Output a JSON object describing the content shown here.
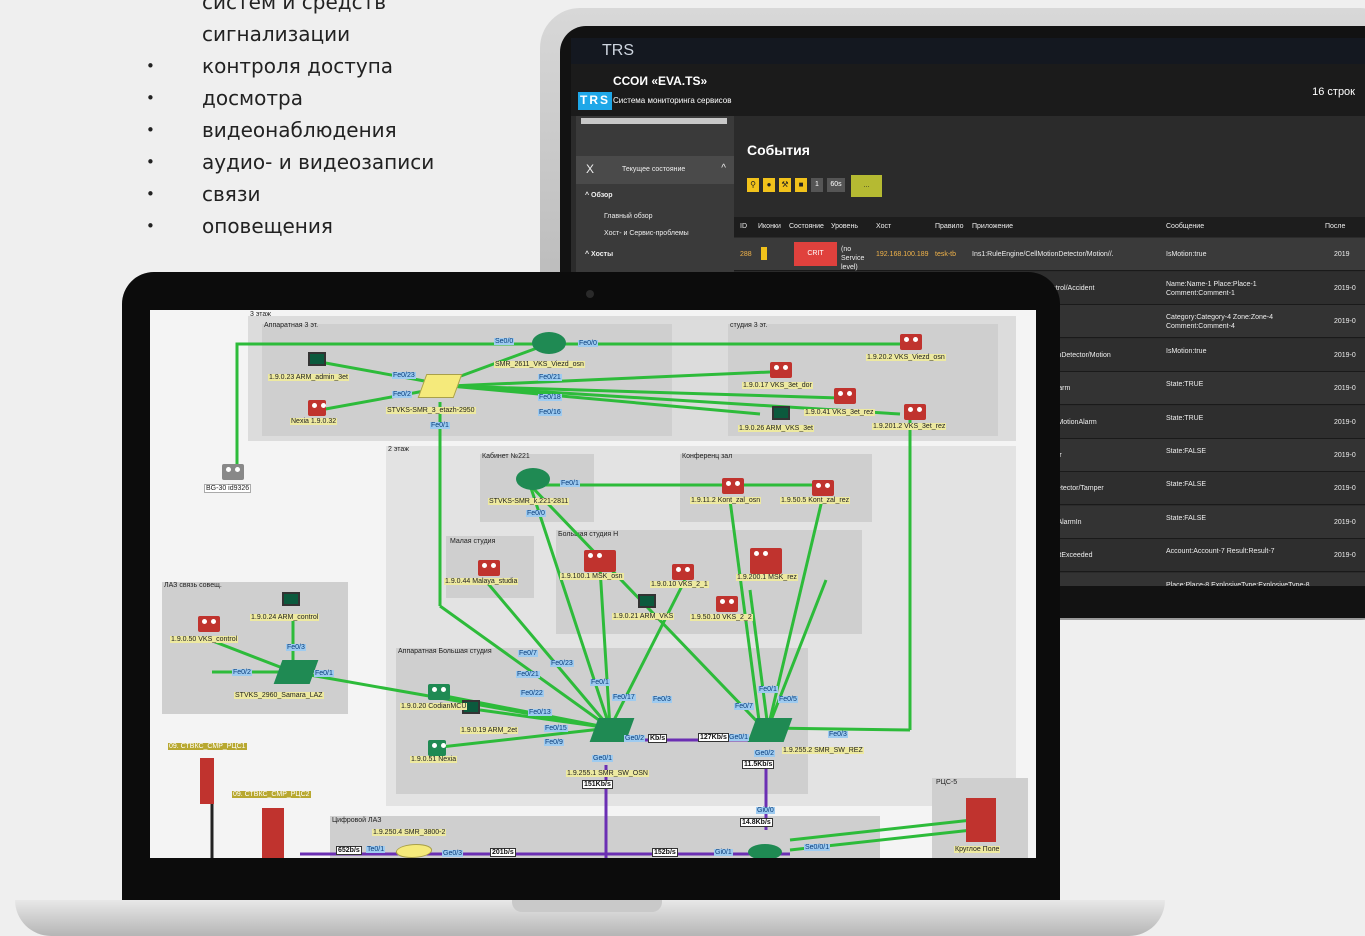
{
  "bullets": {
    "items": [
      "систем и средств",
      "сигнализации",
      "контроля доступа",
      "досмотра",
      "видеонаблюдения",
      "аудио- и видеозаписи",
      "связи",
      "оповещения"
    ],
    "bullet_char": "•"
  },
  "tablet": {
    "titlebar": "TRS",
    "app_name": "ССОИ «EVA.TS»",
    "logo": "TRS",
    "app_subtitle": "Система мониторинга сервисов",
    "rows_count": "16 строк",
    "sidebar": {
      "panel_close": "X",
      "panel_title": "Текущее состояние",
      "overview": "^ Обзор",
      "main_overview": "Главный обзор",
      "host_problems": "Хост- и Сервис-проблемы",
      "hosts": "^ Хосты"
    },
    "events_title": "События",
    "toolbar": {
      "num1": "1",
      "num2": "60s",
      "go": "..."
    },
    "table": {
      "headers": [
        "ID",
        "Иконки",
        "Состояние",
        "Уровень",
        "Хост",
        "Правило",
        "Приложение",
        "Сообщение",
        "После"
      ],
      "first_row": {
        "id": "288",
        "state": "CRIT",
        "level": "(no Service level)",
        "host": "192.168.100.189",
        "rule": "tesk-tb",
        "app": "Ins1:RuleEngine/CellMotionDetector/Motion//.",
        "message": "IsMotion:true",
        "date": "2019"
      },
      "rows": [
        {
          "app": "ntrol/Accident",
          "message": "Name:Name-1 Place:Place-1 Comment:Comment-1",
          "date": "2019-0"
        },
        {
          "app": "re",
          "message": "Category:Category-4 Zone:Zone-4 Comment:Comment-4",
          "date": "2019-0"
        },
        {
          "app": "ionDetector/Motion",
          "message": "IsMotion:true",
          "date": "2019-0"
        },
        {
          "app": "Alarm",
          "message": "State:TRUE",
          "date": "2019-0"
        },
        {
          "app": "k:MotionAlarm",
          "message": "State:TRUE",
          "date": "2019-0"
        },
        {
          "app": "ver",
          "message": "State:FALSE",
          "date": "2019-0"
        },
        {
          "app": "Detector/Tamper",
          "message": "State:FALSE",
          "date": "2019-0"
        },
        {
          "app": "k:AlarmIn",
          "message": "State:FALSE",
          "date": "2019-0"
        },
        {
          "app": "mitExceeded",
          "message": "Account:Account-7 Result:Result-7",
          "date": "2019-0"
        },
        {
          "app": "",
          "message": "Place:Place-8 ExplosiveType:ExplosiveType-8",
          "date": "2019-0"
        }
      ]
    }
  },
  "network": {
    "zones": {
      "floor3": "3 этаж",
      "server3": "Аппаратная 3 эт.",
      "studio3": "студия 3 эт.",
      "floor2": "2 этаж",
      "cabinet": "Кабинет №221",
      "conf": "Конференц зал",
      "small_studio": "Малая студия",
      "big_studio": "Большая студия Н",
      "laz": "ЛАЗ связь совещ.",
      "server_big": "Аппаратная Большая студия",
      "digital_laz": "Цифровой ЛАЗ",
      "rcs5": "РЦС-5"
    },
    "nodes": {
      "smr2611": "SMR_2611_VKS_Viezd_osn",
      "arm_admin": "1.9.0.23 ARM_admin_3et",
      "nexia3": "Nexia 1.9.0.32",
      "stvks_smr3": "STVKS-SMR_3_etazh-2950",
      "vks_viezd": "1.9.20.2 VKS_Viezd_osn",
      "vks_3et_dor": "1.9.0.17 VKS_3et_dor",
      "vks_3et_rez": "1.9.0.41 VKS_3et_rez",
      "arm_vks_3et": "1.9.0.26 ARM_VKS_3et",
      "vks_3et_rez2": "1.9.201.2 VKS_3et_rez",
      "bg30": "BG-30 id9326",
      "stvks_221": "STVKS-SMR_k.221-2811",
      "kont_osn": "1.9.11.2 Kont_zal_osn",
      "kont_rez": "1.9.50.5 Kont_zal_rez",
      "malaya": "1.9.0.44 Malaya_studia",
      "msk_osn": "1.9.100.1 MSK_osn",
      "vks_2_1": "1.9.0.10 VKS_2_1",
      "msk_rez": "1.9.200.1 MSK_rez",
      "arm_vks": "1.9.0.21 ARM_VKS",
      "vks_2_2": "1.9.50.10 VKS_2_2",
      "arm_control": "1.9.0.24 ARM_control",
      "vks_control": "1.9.0.50 VKS_control",
      "stvks_laz": "STVKS_2960_Samara_LAZ",
      "codian": "1.9.0.20 CodianMCU",
      "arm_2et": "1.9.0.19 ARM_2et",
      "nexia_51": "1.9.0.51 Nexia",
      "sw_osn": "1.9.255.1 SMR_SW_OSN",
      "sw_rez": "1.9.255.2 SMR_SW_REZ",
      "rc1": "09. СТВКС_СМР_РЦС1",
      "rc2": "09. СТВКС_СМР_РЦС2",
      "smr3800": "1.9.250.4 SMR_3800-2",
      "krugloe": "Круглое Поле"
    },
    "ports": [
      "Se0/0",
      "Fe0/0",
      "Fe0/23",
      "Fe0/21",
      "Fe0/2",
      "Fe0/18",
      "Fe0/16",
      "Fe0/1",
      "Fe0/1",
      "Fe0/0",
      "Fe0/3",
      "Fe0/2",
      "Fe0/1",
      "Fe0/7",
      "Fe0/23",
      "Fe0/21",
      "Fe0/22",
      "Fe0/13",
      "Fe0/15",
      "Fe0/9",
      "Fe0/1",
      "Fe0/17",
      "Fe0/3",
      "Fe0/1",
      "Fe0/5",
      "Fe0/7",
      "Fe0/3",
      "Ge0/2",
      "Ge0/1",
      "Ge0/2",
      "Gi0/0",
      "Gi0/1",
      "Se0/0/1",
      "Te0/1",
      "Ge0/3",
      "Ge0/1"
    ],
    "rates": [
      "Kb/s",
      "127Kb/s",
      "11.5Kb/s",
      "151Kb/s",
      "14.8Kb/s",
      "652b/s",
      "201b/s",
      "152b/s"
    ]
  },
  "colors": {
    "accent": "#f1c21b",
    "crit": "#e0413d",
    "link_green": "#2dbb3a",
    "link_purple": "#6b2fb3"
  }
}
